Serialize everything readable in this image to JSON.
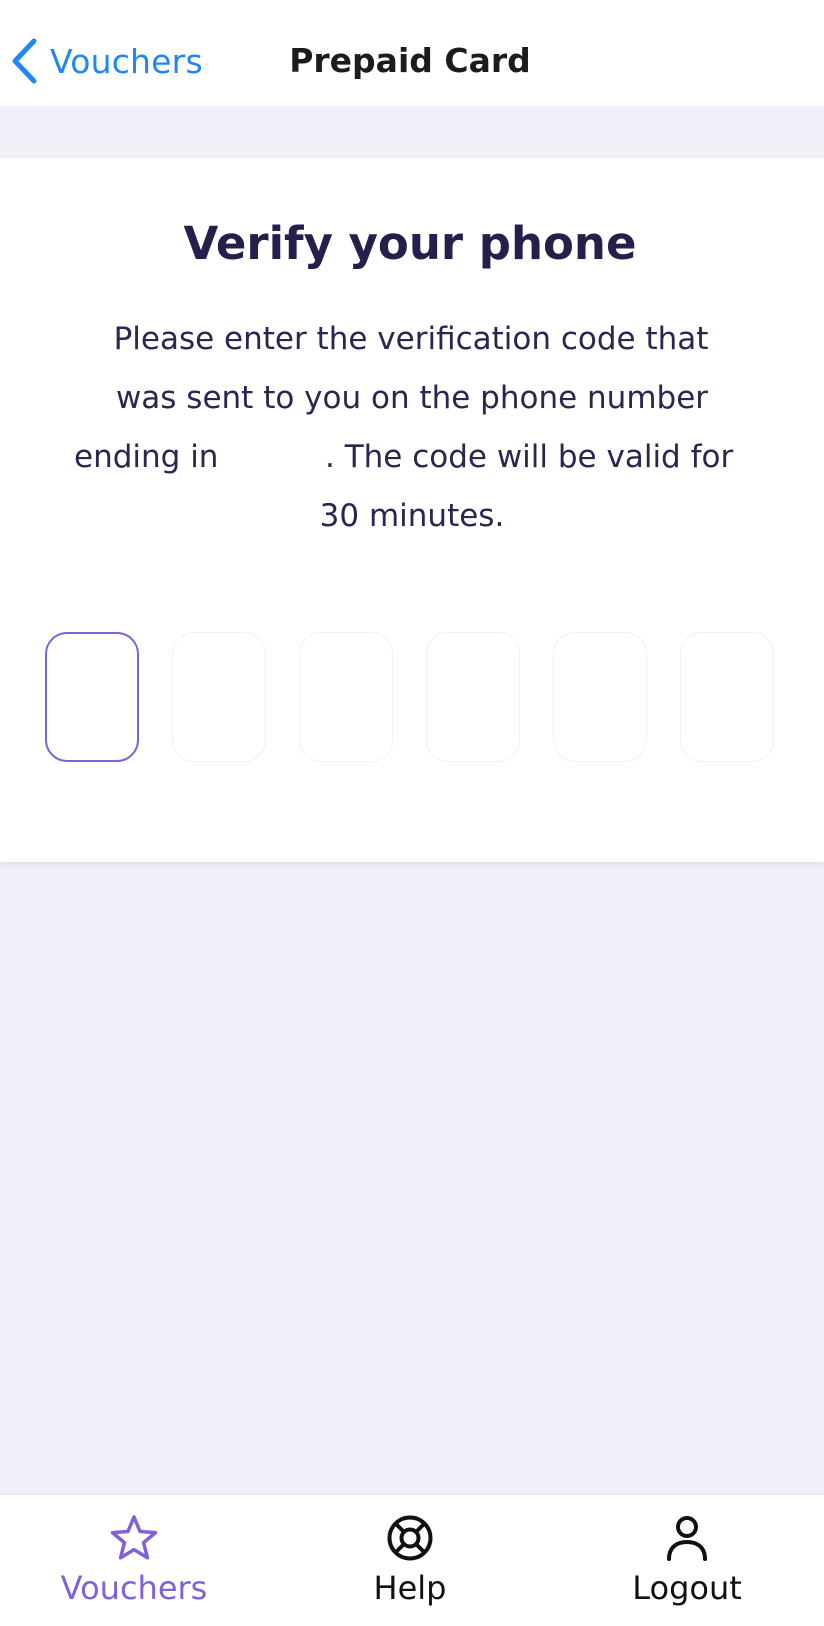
{
  "navbar": {
    "back_label": "Vouchers",
    "title": "Prepaid Card",
    "back_icon": "chevron-left-icon",
    "accent_color": "#1f86f4"
  },
  "verify": {
    "title": "Verify your phone",
    "desc_line1": "Please enter the verification code that",
    "desc_line2": "was sent to you on the phone number",
    "desc_line3_left": "ending in",
    "desc_line3_right": ". The code will be valid for",
    "desc_line4": "30 minutes."
  },
  "code": {
    "digits": [
      "",
      "",
      "",
      "",
      "",
      ""
    ],
    "active_index": 0,
    "active_color": "#8160d8"
  },
  "tabbar": {
    "tabs": [
      {
        "label": "Vouchers",
        "icon": "star-icon",
        "active": true,
        "color": "#8160d8"
      },
      {
        "label": "Help",
        "icon": "lifebuoy-icon",
        "active": false,
        "color": "#111111"
      },
      {
        "label": "Logout",
        "icon": "user-icon",
        "active": false,
        "color": "#111111"
      }
    ]
  }
}
